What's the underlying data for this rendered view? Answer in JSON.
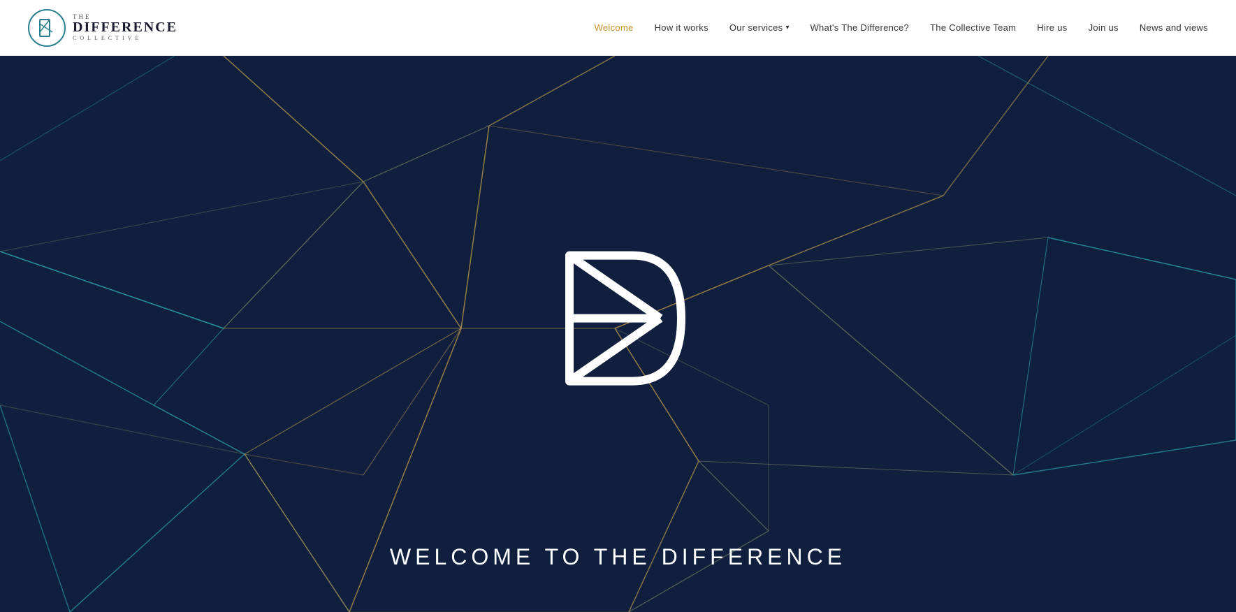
{
  "header": {
    "logo": {
      "icon_letter": "D",
      "the": "THE",
      "difference": "DIFFERENCE",
      "collective": "COLLECTIVE"
    },
    "nav": {
      "items": [
        {
          "id": "welcome",
          "label": "Welcome",
          "active": true
        },
        {
          "id": "how-it-works",
          "label": "How it works",
          "active": false
        },
        {
          "id": "our-services",
          "label": "Our services",
          "active": false,
          "has_dropdown": true
        },
        {
          "id": "whats-the-difference",
          "label": "What's The Difference?",
          "active": false
        },
        {
          "id": "the-collective-team",
          "label": "The Collective Team",
          "active": false
        },
        {
          "id": "hire-us",
          "label": "Hire us",
          "active": false
        },
        {
          "id": "join-us",
          "label": "Join us",
          "active": false
        },
        {
          "id": "news-and-views",
          "label": "News and views",
          "active": false
        }
      ]
    }
  },
  "hero": {
    "title": "WELCOME TO THE DIFFERENCE",
    "bg_color": "#0f1f3d"
  },
  "colors": {
    "teal": "#2a9faa",
    "gold": "#b8944a",
    "olive": "#8a9068",
    "nav_active": "#c8922a",
    "logo_border": "#2a7f8f"
  }
}
